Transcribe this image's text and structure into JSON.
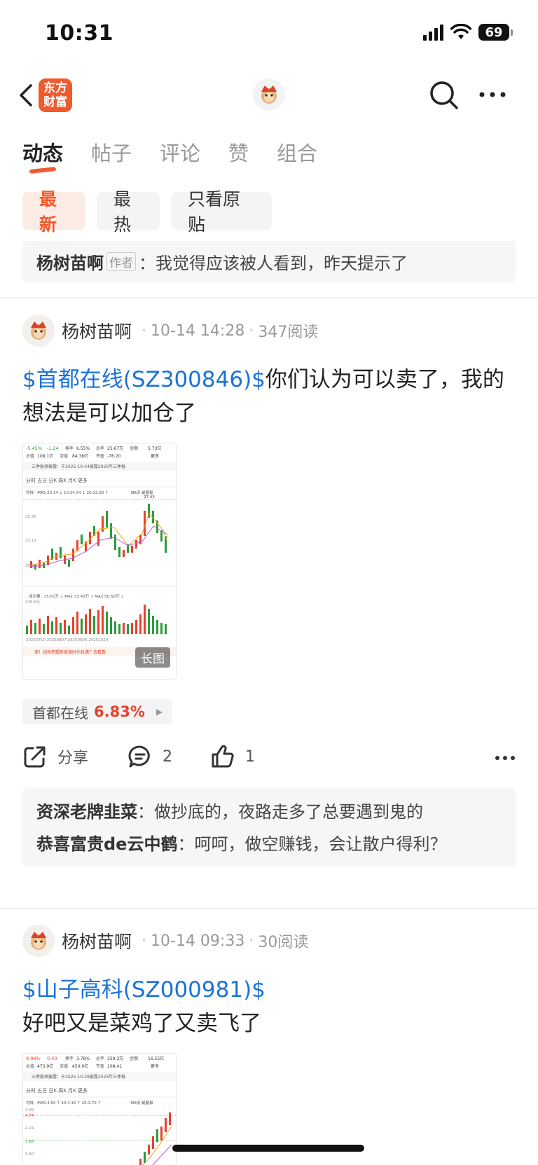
{
  "status": {
    "time": "10:31",
    "battery": "69"
  },
  "nav": {
    "logo_line1": "东方",
    "logo_line2": "财富"
  },
  "tabs": [
    {
      "label": "动态",
      "active": true
    },
    {
      "label": "帖子"
    },
    {
      "label": "评论"
    },
    {
      "label": "赞"
    },
    {
      "label": "组合"
    }
  ],
  "filters": [
    {
      "label": "最新",
      "active": true
    },
    {
      "label": "最热"
    },
    {
      "label": "只看原贴"
    }
  ],
  "pinned": {
    "name": "杨树苗啊",
    "tag": "作者",
    "text": "：我觉得应该被人看到，昨天提示了"
  },
  "posts": [
    {
      "author": "杨树苗啊",
      "time": "10-14 14:28",
      "reads": "347阅读",
      "stock_link": "$首都在线(SZ300846)$",
      "text": "你们认为可以卖了，我的想法是可以加仓了",
      "image_badge": "长图",
      "chart_header": {
        "change_pct": "-5.45%",
        "change": "-1.24",
        "turnover_label": "换手",
        "turnover": "6.55%",
        "total_label": "总手",
        "total": "25.67万",
        "amount_label": "金额",
        "amount": "5.73亿",
        "mcap_label": "总值",
        "mcap": "108.1亿",
        "float_label": "流值",
        "float": "84.38亿",
        "pe_label": "市盈",
        "pe": "-76.20",
        "more": "更多",
        "notice": "三季报预披露：于2025-10-24披露2025年三季报",
        "periods": "分时  五日  日K  周K  月K  更多",
        "ma_line": "均线 · MA5:23.14 ↓  10:24.34 ↓  20:23.28 ↑",
        "dk": "DK点  前复权",
        "y_high": "27.43",
        "y_label1": "25.26",
        "y_label2": "23.13",
        "y_label3": "20.99",
        "vol_line": "成交量 · 25.67万 ↓  MA1:33.43万 ↓  MA2:50.60万 ↓",
        "vol_max": "135.6万",
        "dates": "20250710    20250807    20250905    20251014",
        "footer": "滚！如何把握新能源时代机遇？去看看"
      },
      "stock_chip": {
        "name": "首都在线",
        "pct": "6.83%"
      },
      "share_label": "分享",
      "comments_count": "2",
      "likes_count": "1",
      "comments": [
        {
          "name": "资深老牌韭菜",
          "text": "：做抄底的，夜路走多了总要遇到鬼的"
        },
        {
          "name": "恭喜富贵de云中鹤",
          "text": "：呵呵，做空赚钱，会让散户得利？"
        }
      ]
    },
    {
      "author": "杨树苗啊",
      "time": "10-14 09:33",
      "reads": "30阅读",
      "stock_link": "$山子高科(SZ000981)$",
      "text": "好吧又是菜鸡了又卖飞了",
      "chart_header": {
        "change_pct": "9.98%",
        "change": "0.43",
        "turnover_label": "换手",
        "turnover": "3.78%",
        "total_label": "总手",
        "total": "359.3万",
        "amount_label": "金额",
        "amount": "16.55亿",
        "mcap_label": "总值",
        "mcap": "473.9亿",
        "float_label": "流值",
        "float": "450.9亿",
        "pe_label": "市盈",
        "pe": "108.41",
        "more": "更多",
        "notice": "三季报预披露：于2025-10-29披露2025年三季报",
        "periods": "分时  五日  日K  周K  月K  更多",
        "ma_line": "均线 · MA5:4.50 ↑  10:4.15 ↑  20:3.70 ↑",
        "dk": "DK点  前复权",
        "y_high": "4.99",
        "y_label1": "4.74",
        "y_label2": "4.24",
        "y_label3": "3.68",
        "y_label4": "3.50"
      }
    }
  ]
}
